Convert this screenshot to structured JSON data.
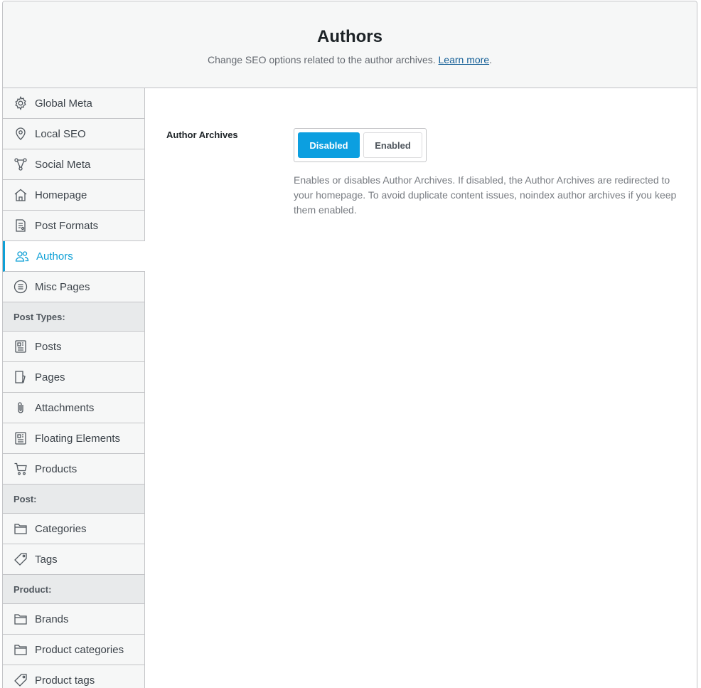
{
  "header": {
    "title": "Authors",
    "subtitle": "Change SEO options related to the author archives.",
    "learn_more": "Learn more",
    "period": "."
  },
  "sidebar": {
    "items": [
      {
        "label": "Global Meta",
        "icon": "gear-icon"
      },
      {
        "label": "Local SEO",
        "icon": "location-pin-icon"
      },
      {
        "label": "Social Meta",
        "icon": "share-nodes-icon"
      },
      {
        "label": "Homepage",
        "icon": "home-icon"
      },
      {
        "label": "Post Formats",
        "icon": "document-icon"
      },
      {
        "label": "Authors",
        "icon": "users-icon",
        "active": true
      },
      {
        "label": "Misc Pages",
        "icon": "list-circle-icon"
      }
    ],
    "post_types_heading": "Post Types:",
    "post_types": [
      {
        "label": "Posts",
        "icon": "post-icon"
      },
      {
        "label": "Pages",
        "icon": "page-icon"
      },
      {
        "label": "Attachments",
        "icon": "paperclip-icon"
      },
      {
        "label": "Floating Elements",
        "icon": "post-icon"
      },
      {
        "label": "Products",
        "icon": "cart-icon"
      }
    ],
    "post_heading": "Post:",
    "post_tax": [
      {
        "label": "Categories",
        "icon": "folder-icon"
      },
      {
        "label": "Tags",
        "icon": "tag-icon"
      }
    ],
    "product_heading": "Product:",
    "product_tax": [
      {
        "label": "Brands",
        "icon": "folder-icon"
      },
      {
        "label": "Product categories",
        "icon": "folder-icon"
      },
      {
        "label": "Product tags",
        "icon": "tag-icon"
      }
    ]
  },
  "main": {
    "field_label": "Author Archives",
    "toggle": {
      "disabled_label": "Disabled",
      "enabled_label": "Enabled",
      "selected": "Disabled"
    },
    "description": "Enables or disables Author Archives. If disabled, the Author Archives are redirected to your homepage. To avoid duplicate content issues, noindex author archives if you keep them enabled."
  },
  "colors": {
    "accent": "#0c9fe0",
    "active_text": "#0ea0d6",
    "border": "#c3c4c7"
  }
}
